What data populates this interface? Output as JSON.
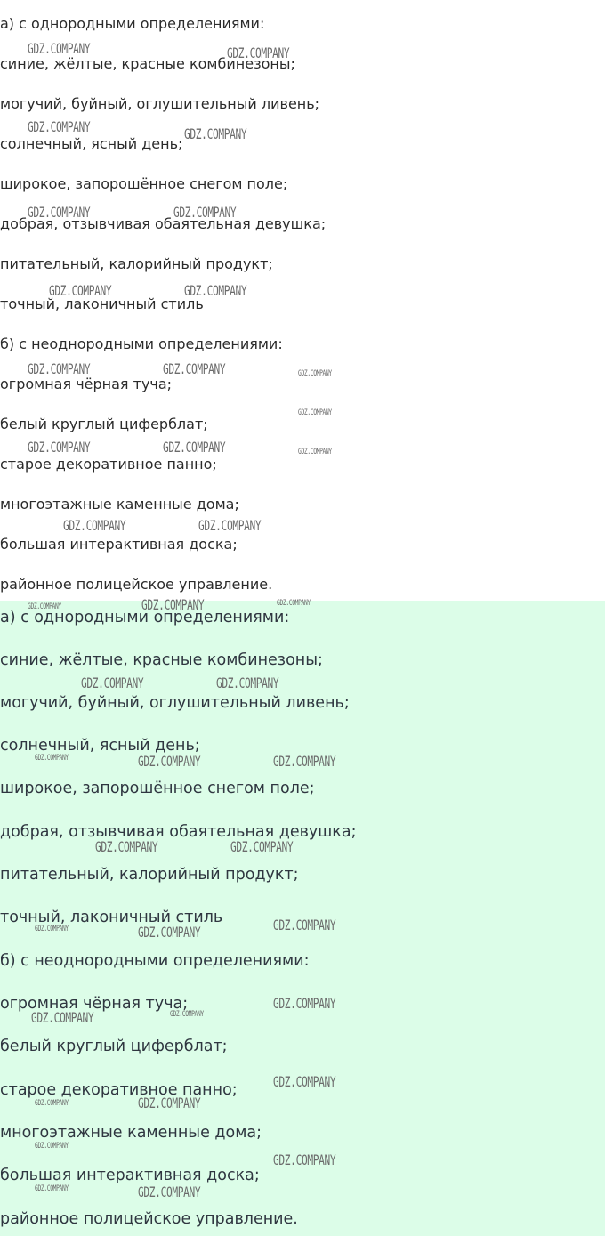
{
  "watermark": "GDZ.COMPANY",
  "top": {
    "lines": [
      "а) с однородными определениями:",
      "синие, жёлтые, красные комбинезоны;",
      "могучий, буйный, оглушительный ливень;",
      "солнечный, ясный день;",
      "широкое, запорошённое снегом поле;",
      "добрая, отзывчивая обаятельная девушка;",
      "питательный, калорийный продукт;",
      "точный, лаконичный стиль",
      "б) с неоднородными определениями:",
      "огромная чёрная туча;",
      "белый круглый циферблат;",
      "старое декоративное панно;",
      "многоэтажные каменные дома;",
      "большая интерактивная доска;",
      "районное полицейское управление."
    ]
  },
  "bottom": {
    "lines": [
      "а) с однородными определениями:",
      "синие, жёлтые, красные комбинезоны;",
      "могучий, буйный, оглушительный ливень;",
      "солнечный, ясный день;",
      "широкое, запорошённое снегом поле;",
      "добрая, отзывчивая обаятельная девушка;",
      "питательный, калорийный продукт;",
      "точный, лаконичный стиль",
      "б) с неоднородными определениями:",
      "огромная чёрная туча;",
      "белый круглый циферблат;",
      "старое декоративное панно;",
      "многоэтажные каменные дома;",
      "большая интерактивная доска;",
      "районное полицейское управление."
    ]
  },
  "colors": {
    "bottom_background": "#dcfde8",
    "text": "#2b2b2b"
  }
}
